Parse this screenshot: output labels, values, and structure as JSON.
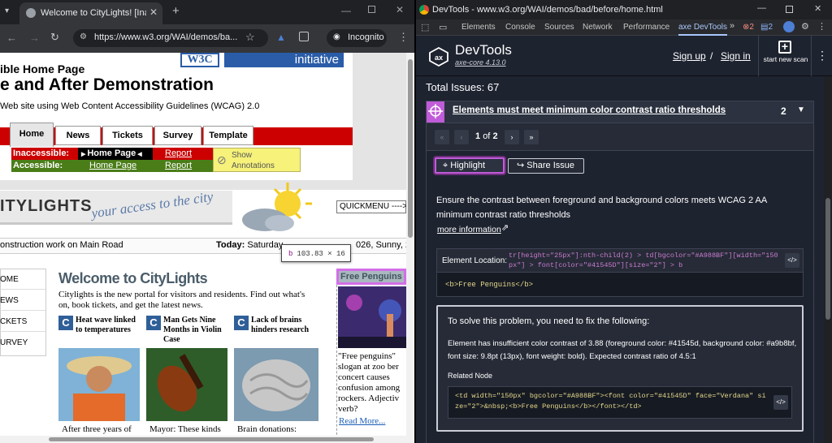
{
  "left_browser": {
    "tab_title": "Welcome to CityLights! [Inacce",
    "url": "https://www.w3.org/WAI/demos/ba...",
    "incognito_label": "Incognito",
    "page": {
      "logo_text": "W3C",
      "logo_initiative": "initiative",
      "heading_small": "ible Home Page",
      "heading_large": "e and After Demonstration",
      "subheading": "Web site using Web Content Accessibility Guidelines (WCAG) 2.0",
      "nav_tabs": [
        "Home",
        "News",
        "Tickets",
        "Survey",
        "Template"
      ],
      "inaccessible_label": "Inaccessible:",
      "accessible_label": "Accessible:",
      "home_page_label": "Home Page",
      "report_label": "Report",
      "show_annotations": "Show\nAnnotations",
      "citylights_logo": "ITYLIGHTS",
      "slogan": "your access to the city",
      "quickmenu": "QUICKMENU ---->",
      "ticker": "onstruction work on Main Road",
      "today_label": "Today:",
      "today_value": "Saturday",
      "today_rest": "026, Sunny, 2",
      "tooltip_tag": "b",
      "tooltip_size": "103.83 × 16",
      "side_nav": [
        "OME",
        "EWS",
        "CKETS",
        "URVEY"
      ],
      "welcome_heading": "Welcome to CityLights",
      "welcome_text": "Citylights is the new portal for visitors and residents. Find out what's on, book tickets, and get the latest news.",
      "news": [
        {
          "title": "Heat wave linked to temperatures",
          "caption": "After three years of"
        },
        {
          "title": "Man Gets Nine Months in Violin Case",
          "caption": "Mayor: These kinds"
        },
        {
          "title": "Lack of brains hinders research",
          "caption": "Brain donations:"
        }
      ],
      "free_penguins": "Free Penguins",
      "penguin_text": "\"Free penguins\" slogan at zoo ber concert causes confusion among rockers. Adjectiv verb?",
      "read_more": "Read More..."
    }
  },
  "devtools": {
    "window_title": "DevTools - www.w3.org/WAI/demos/bad/before/home.html",
    "tabs": [
      "Elements",
      "Console",
      "Sources",
      "Network",
      "Performance",
      "axe DevTools"
    ],
    "error_count": "2",
    "message_count": "2",
    "axe": {
      "brand": "DevTools",
      "version": "axe-core 4.13.0",
      "sign_up": "Sign up",
      "separator": "/",
      "sign_in": "Sign in",
      "start_scan": "start new scan",
      "total_issues": "Total Issues: 67",
      "issue_title": "Elements must meet minimum color contrast ratio thresholds",
      "issue_count": "2",
      "pager_current": "1",
      "pager_of": "of",
      "pager_total": "2",
      "highlight_label": "Highlight",
      "share_label": "Share Issue",
      "description": "Ensure the contrast between foreground and background colors meets WCAG 2 AA minimum contrast ratio thresholds",
      "more_info": "more information",
      "element_location_label": "Element Location:",
      "element_location": "tr[height=\"25px\"]:nth-child(2) > td[bgcolor=\"#A988BF\"][width=\"150px\"] > font[color=\"#41545D\"][size=\"2\"] > b",
      "element_source": "<b>Free Penguins</b>",
      "solve_heading": "To solve this problem, you need to fix the following:",
      "solve_text": "Element has insufficient color contrast of 3.88 (foreground color: #41545d, background color: #a9b8bf, font size: 9.8pt (13px), font weight: bold). Expected contrast ratio of 4.5:1",
      "related_node_label": "Related Node",
      "related_node_code": "<td width=\"150px\" bgcolor=\"#A988BF\"><font color=\"#41545D\" face=\"Verdana\" size=\"2\">&nbsp;<b>Free Penguins</b></font></td>"
    }
  },
  "colors": {
    "axe_purple": "#c05bd9",
    "axe_bg": "#1e2330",
    "page_red": "#cc0000",
    "page_green": "#4a7d18"
  }
}
